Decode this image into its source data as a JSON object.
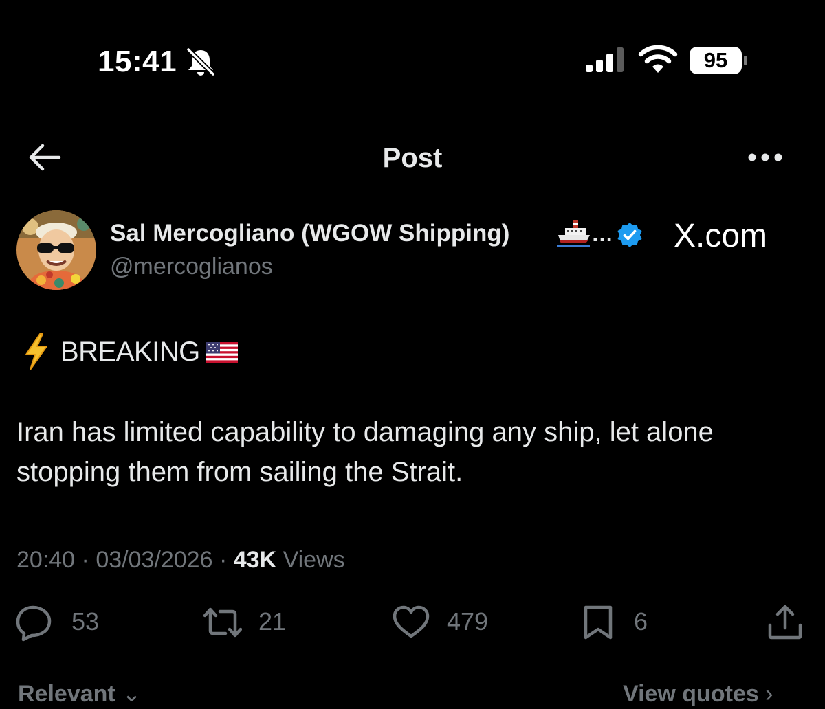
{
  "status_bar": {
    "time": "15:41",
    "battery_level": "95",
    "icons": [
      "bell-slash-icon",
      "signal-icon",
      "wifi-icon",
      "battery-icon"
    ]
  },
  "header": {
    "title": "Post",
    "back_icon": "arrow-left-icon",
    "more_icon": "more-horizontal-icon"
  },
  "post": {
    "author_name": "Sal Mercogliano (WGOW Shipping)",
    "author_name_suffix": "…",
    "handle": "@mercoglianos",
    "verified": true,
    "watermark": "X.com",
    "breaking_label": "BREAKING",
    "text": "Iran has limited capability to damaging any ship, let alone stopping them from sailing the Strait.",
    "time": "20:40",
    "separator": "·",
    "date": "03/03/2026",
    "views_count": "43K",
    "views_label": "Views"
  },
  "actions": {
    "replies": "53",
    "reposts": "21",
    "likes": "479",
    "bookmarks": "6"
  },
  "footer": {
    "sort_label": "Relevant",
    "view_quotes_label": "View quotes"
  },
  "colors": {
    "background": "#000000",
    "text_primary": "#e7e9ea",
    "text_secondary": "#71767b",
    "verified_blue": "#1d9bf0"
  }
}
